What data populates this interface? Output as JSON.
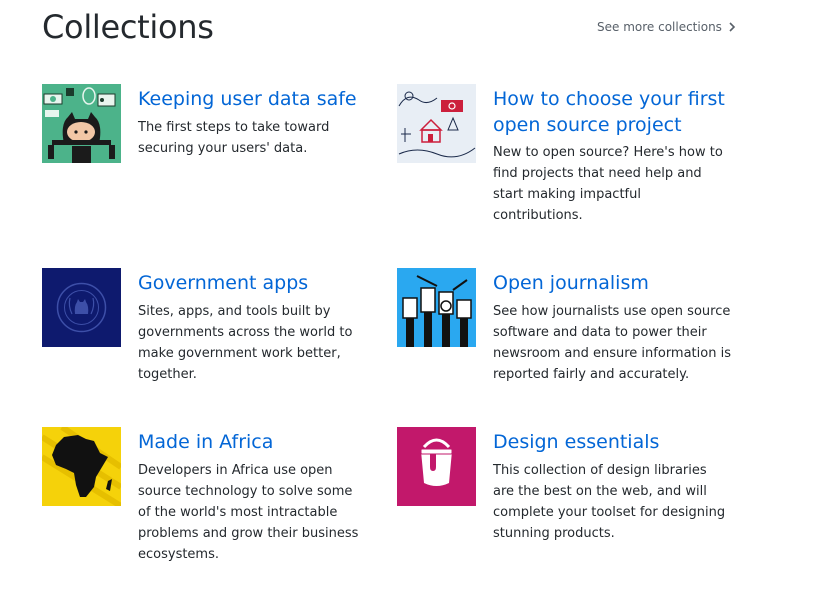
{
  "header": {
    "title": "Collections",
    "see_more_label": "See more collections"
  },
  "collections": [
    {
      "title": "Keeping user data safe",
      "description": "The first steps to take toward securing your users' data.",
      "icon": "octocat-security-icon",
      "color": "#4cb38a"
    },
    {
      "title": "How to choose your first open source project",
      "description": "New to open source? Here's how to find projects that need help and start making impactful contributions.",
      "icon": "house-map-icon",
      "color": "#e8eef5"
    },
    {
      "title": "Government apps",
      "description": "Sites, apps, and tools built by governments across the world to make government work better, together.",
      "icon": "government-seal-icon",
      "color": "#0e1a6e"
    },
    {
      "title": "Open journalism",
      "description": "See how journalists use open source software and data to power their newsroom and ensure information is reported fairly and accurately.",
      "icon": "raised-fists-icon",
      "color": "#2aa8f0"
    },
    {
      "title": "Made in Africa",
      "description": "Developers in Africa use open source technology to solve some of the world's most intractable problems and grow their business ecosystems.",
      "icon": "africa-map-icon",
      "color": "#f5d20a"
    },
    {
      "title": "Design essentials",
      "description": "This collection of design libraries are the best on the web, and will complete your toolset for designing stunning products.",
      "icon": "paint-bucket-icon",
      "color": "#c2186b"
    }
  ]
}
